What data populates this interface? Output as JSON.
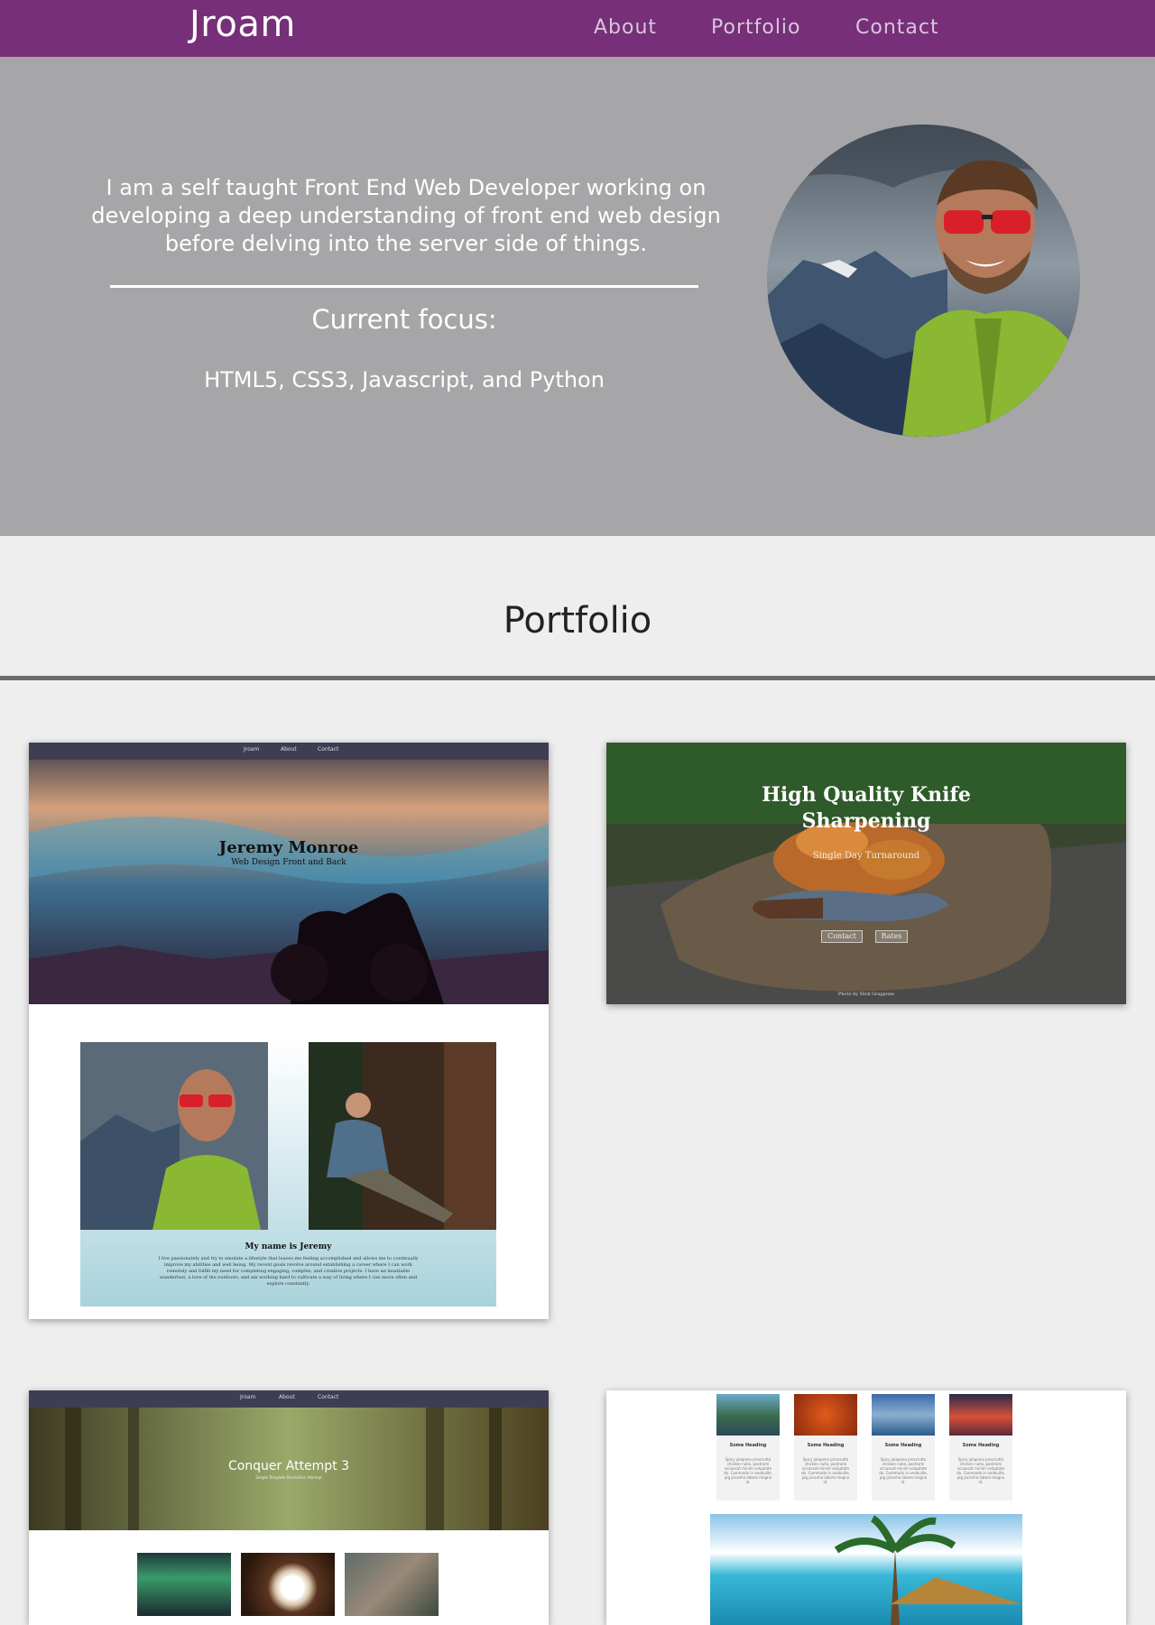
{
  "nav": {
    "brand": "Jroam",
    "links": [
      "About",
      "Portfolio",
      "Contact"
    ]
  },
  "hero": {
    "intro": "I am a self taught Front End Web Developer working on developing a deep understanding of front end web design before delving into the server side of things.",
    "focus_title": "Current focus:",
    "focus_list": "HTML5, CSS3, Javascript, and Python"
  },
  "portfolio": {
    "title": "Portfolio",
    "card1": {
      "nav": [
        "Jroam",
        "About",
        "Contact"
      ],
      "title": "Jeremy Monroe",
      "subtitle": "Web Design Front and Back",
      "about_heading": "My name is Jeremy",
      "about_text": "I live passionately and try to emulate a lifestyle that leaves me feeling accomplished and allows me to continually improve my abilities and well being. My recent goals revolve around establishing a career where I can work remotely and fulfill my need for completing engaging, complex, and creative projects. I have an insatiable wanderlust, a love of the outdoors, and am working hard to cultivate a way of living where I can move often and explore constantly."
    },
    "card2": {
      "title": "High Quality Knife Sharpening",
      "subtitle": "Single Day Turnaround",
      "buttons": [
        "Contact",
        "Rates"
      ],
      "credit": "Photo by Nick Grappone"
    },
    "card3": {
      "nav": [
        "Jroam",
        "About",
        "Contact"
      ],
      "title": "Conquer Attempt 3",
      "subtitle": "Simple Template Recreation Attempt"
    },
    "card4": {
      "headings": [
        "Some Heading",
        "Some Heading",
        "Some Heading",
        "Some Heading"
      ],
      "text": "Spicy jalapeno prosciutto chicken nulla, pastrami occaecat minim voluptate do. Commodo in andouille, pig picanha labore magna id."
    }
  }
}
